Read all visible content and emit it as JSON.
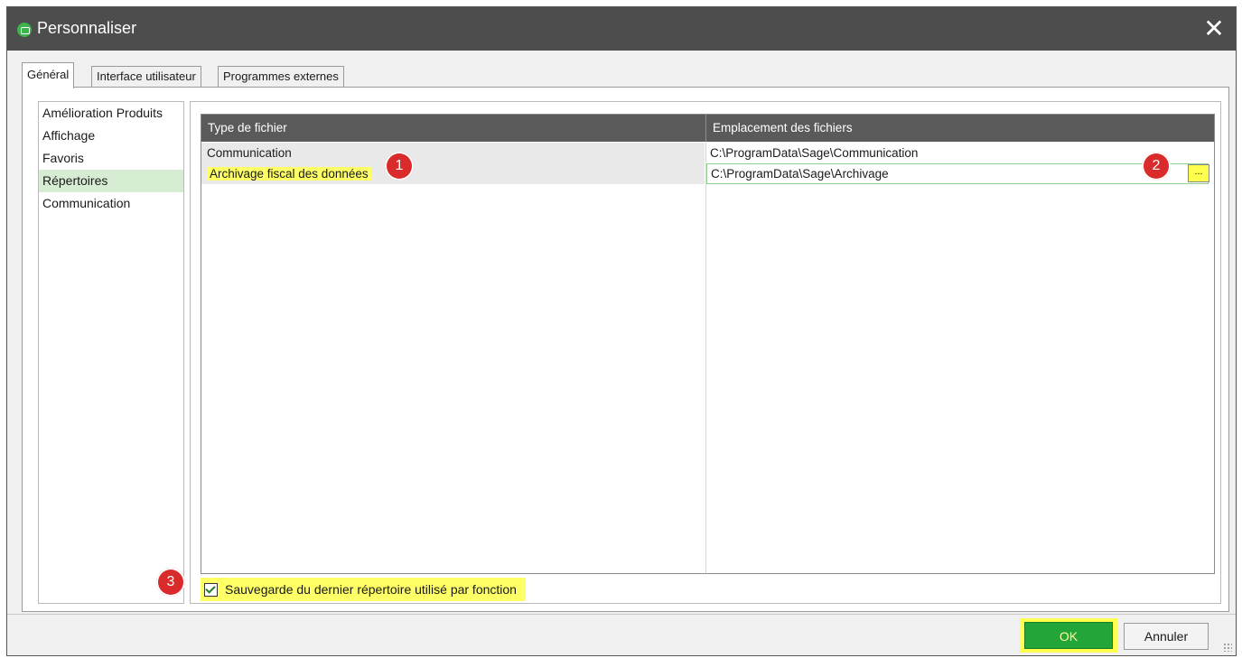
{
  "window": {
    "title": "Personnaliser",
    "close_icon": "close-icon",
    "app_icon": "sage-app-icon"
  },
  "tabs": [
    {
      "label": "Général"
    },
    {
      "label": "Interface utilisateur"
    },
    {
      "label": "Programmes externes"
    }
  ],
  "categories": [
    {
      "label": "Amélioration Produits"
    },
    {
      "label": "Affichage"
    },
    {
      "label": "Favoris"
    },
    {
      "label": "Répertoires",
      "selected": true
    },
    {
      "label": "Communication"
    }
  ],
  "grid": {
    "headers": [
      "Type de fichier",
      "Emplacement des fichiers"
    ],
    "rows": [
      {
        "type": "Communication",
        "location": "C:\\ProgramData\\Sage\\Communication"
      },
      {
        "type": "Archivage fiscal des données",
        "location": "C:\\ProgramData\\Sage\\Archivage"
      }
    ],
    "browse_label": "..."
  },
  "callouts": [
    "1",
    "2",
    "3"
  ],
  "checkbox": {
    "label": "Sauvegarde du dernier répertoire utilisé par fonction",
    "checked": true
  },
  "buttons": {
    "ok": "OK",
    "cancel": "Annuler"
  },
  "colors": {
    "titlebar": "#4d4d4d",
    "highlight": "#ffff66",
    "ok_green": "#23a53a",
    "callout_red": "#d92b2b",
    "selected_item": "#d6ecd3"
  }
}
